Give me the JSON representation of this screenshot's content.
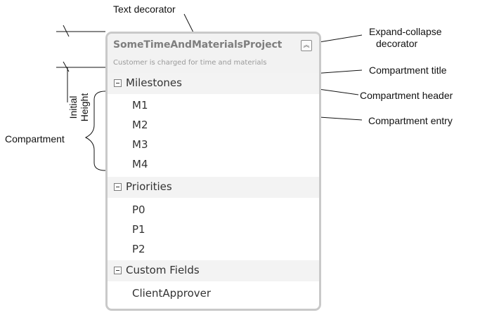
{
  "shape": {
    "title": "SomeTimeAndMaterialsProject",
    "subtitle": "Customer is charged for time and materials",
    "expand_icon": "double-chevron-up-icon",
    "compartments": [
      {
        "title": "Milestones",
        "entries": [
          "M1",
          "M2",
          "M3",
          "M4"
        ]
      },
      {
        "title": "Priorities",
        "entries": [
          "P0",
          "P1",
          "P2"
        ]
      },
      {
        "title": "Custom Fields",
        "entries": [
          "ClientApprover"
        ]
      }
    ]
  },
  "callouts": {
    "text_decorator": "Text decorator",
    "expand_collapse_line1": "Expand-collapse",
    "expand_collapse_line2": "decorator",
    "compartment_title": "Compartment title",
    "compartment_header": "Compartment  header",
    "compartment_entry": "Compartment entry",
    "initial_height_line1": "Initial",
    "initial_height_line2": "Height",
    "compartment": "Compartment"
  }
}
